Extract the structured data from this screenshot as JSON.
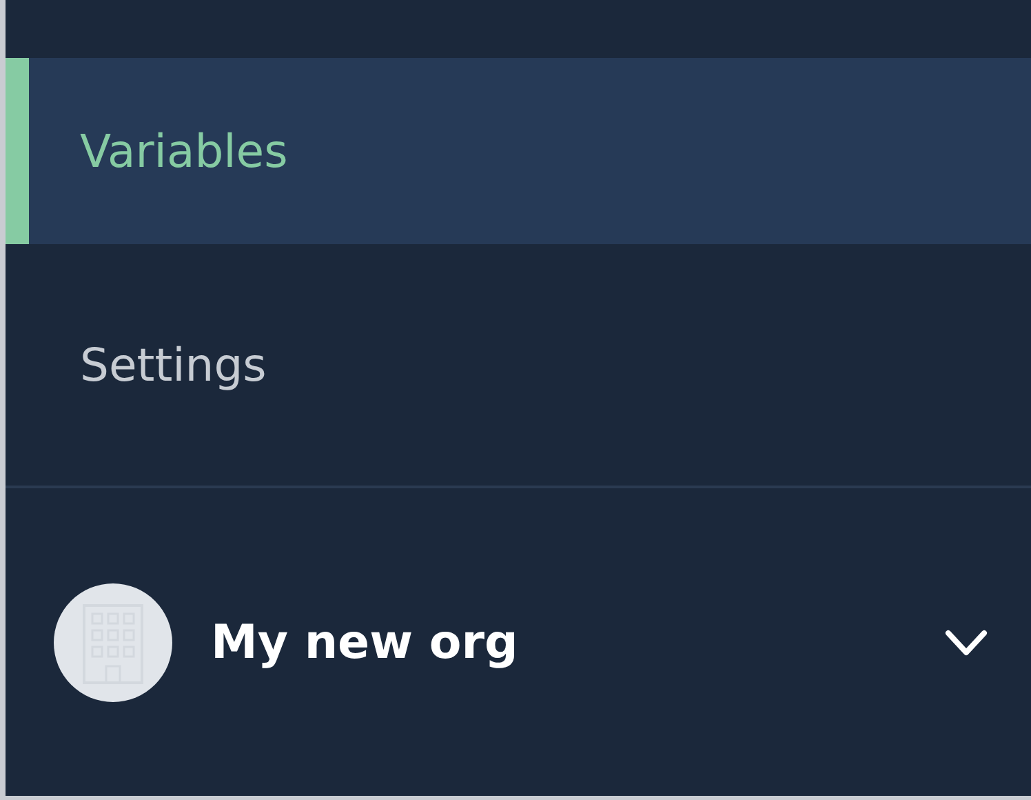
{
  "nav_items": [
    {
      "label": "Variables",
      "selected": true
    },
    {
      "label": "Settings",
      "selected": false
    }
  ],
  "org_switcher": {
    "name": "My new org",
    "expanded": false
  }
}
